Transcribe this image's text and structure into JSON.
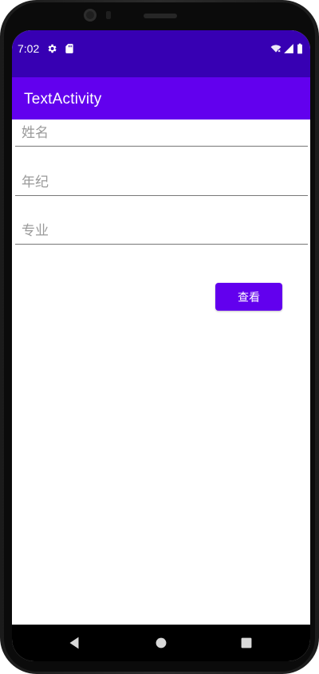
{
  "status_bar": {
    "time": "7:02",
    "icons": [
      "gear-icon",
      "sd-card-icon",
      "wifi-icon",
      "signal-icon",
      "battery-icon"
    ],
    "background": "#3700b3"
  },
  "app_bar": {
    "title": "TextActivity",
    "background": "#6200ee"
  },
  "form": {
    "name_placeholder": "姓名",
    "age_placeholder": "年纪",
    "major_placeholder": "专业",
    "view_button_label": "查看",
    "accent": "#6200ee"
  },
  "nav_bar": {
    "buttons": [
      "back-icon",
      "home-icon",
      "recents-icon"
    ]
  }
}
